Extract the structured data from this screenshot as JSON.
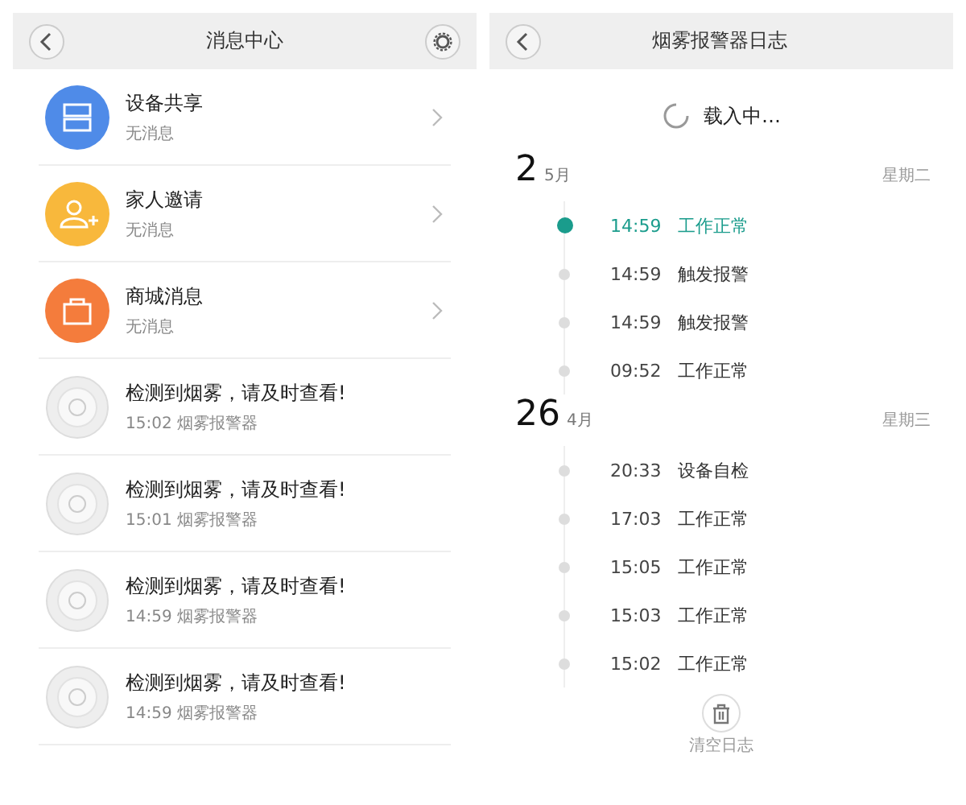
{
  "message_center": {
    "title": "消息中心",
    "categories": [
      {
        "kind": "share",
        "color": "#4f8be8",
        "title": "设备共享",
        "subtitle": "无消息"
      },
      {
        "kind": "invite",
        "color": "#f8b83c",
        "title": "家人邀请",
        "subtitle": "无消息"
      },
      {
        "kind": "shop",
        "color": "#f47c3c",
        "title": "商城消息",
        "subtitle": "无消息"
      }
    ],
    "alerts": [
      {
        "title": "检测到烟雾，请及时查看!",
        "time": "15:02",
        "device": "烟雾报警器"
      },
      {
        "title": "检测到烟雾，请及时查看!",
        "time": "15:01",
        "device": "烟雾报警器"
      },
      {
        "title": "检测到烟雾，请及时查看!",
        "time": "14:59",
        "device": "烟雾报警器"
      },
      {
        "title": "检测到烟雾，请及时查看!",
        "time": "14:59",
        "device": "烟雾报警器"
      }
    ]
  },
  "log": {
    "title": "烟雾报警器日志",
    "loading": "载入中…",
    "days": [
      {
        "day": "2",
        "month": "5月",
        "weekday": "星期二",
        "entries": [
          {
            "time": "14:59",
            "event": "工作正常",
            "current": true
          },
          {
            "time": "14:59",
            "event": "触发报警",
            "current": false
          },
          {
            "time": "14:59",
            "event": "触发报警",
            "current": false
          },
          {
            "time": "09:52",
            "event": "工作正常",
            "current": false
          }
        ]
      },
      {
        "day": "26",
        "month": "4月",
        "weekday": "星期三",
        "entries": [
          {
            "time": "20:33",
            "event": "设备自检",
            "current": false
          },
          {
            "time": "17:03",
            "event": "工作正常",
            "current": false
          },
          {
            "time": "15:05",
            "event": "工作正常",
            "current": false
          },
          {
            "time": "15:03",
            "event": "工作正常",
            "current": false
          },
          {
            "time": "15:02",
            "event": "工作正常",
            "current": false
          }
        ]
      }
    ],
    "clear_label": "清空日志"
  }
}
